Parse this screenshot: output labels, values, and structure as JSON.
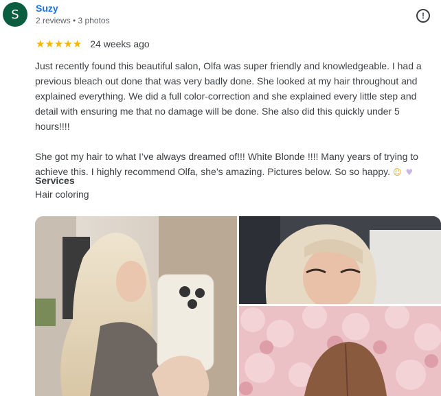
{
  "reviewer": {
    "initial": "S",
    "name": "Suzy",
    "meta": "2 reviews • 3 photos"
  },
  "rating": {
    "stars": 5,
    "stars_text": "★★★★★",
    "time": "24 weeks ago"
  },
  "review_text": "Just recently found this beautiful salon, Olfa was super friendly and knowledgeable. I had a previous bleach out done that was very badly done. She looked at my hair throughout and explained everything. We did a full color-correction and she explained every little step and detail with ensuring me that no damage will be done. She also did this quickly under 5 hours!!!!\n\nShe got my hair to what I’ve always dreamed of!!! White Blonde !!!! Many years of trying to achieve this. I highly recommend Olfa, she’s amazing. Pictures below. So so happy.",
  "emojis": [
    "smiling-face-icon",
    "heart-icon"
  ],
  "services": {
    "label": "Services",
    "value": "Hair coloring"
  },
  "icons": {
    "more": "report-icon"
  },
  "colors": {
    "avatar": "#0b5d3f",
    "name": "#1a73e8",
    "stars": "#f8b400"
  },
  "photos": [
    {
      "name": "mirror-selfie-photo"
    },
    {
      "name": "blonde-bob-photo"
    },
    {
      "name": "floral-wall-photo"
    }
  ]
}
